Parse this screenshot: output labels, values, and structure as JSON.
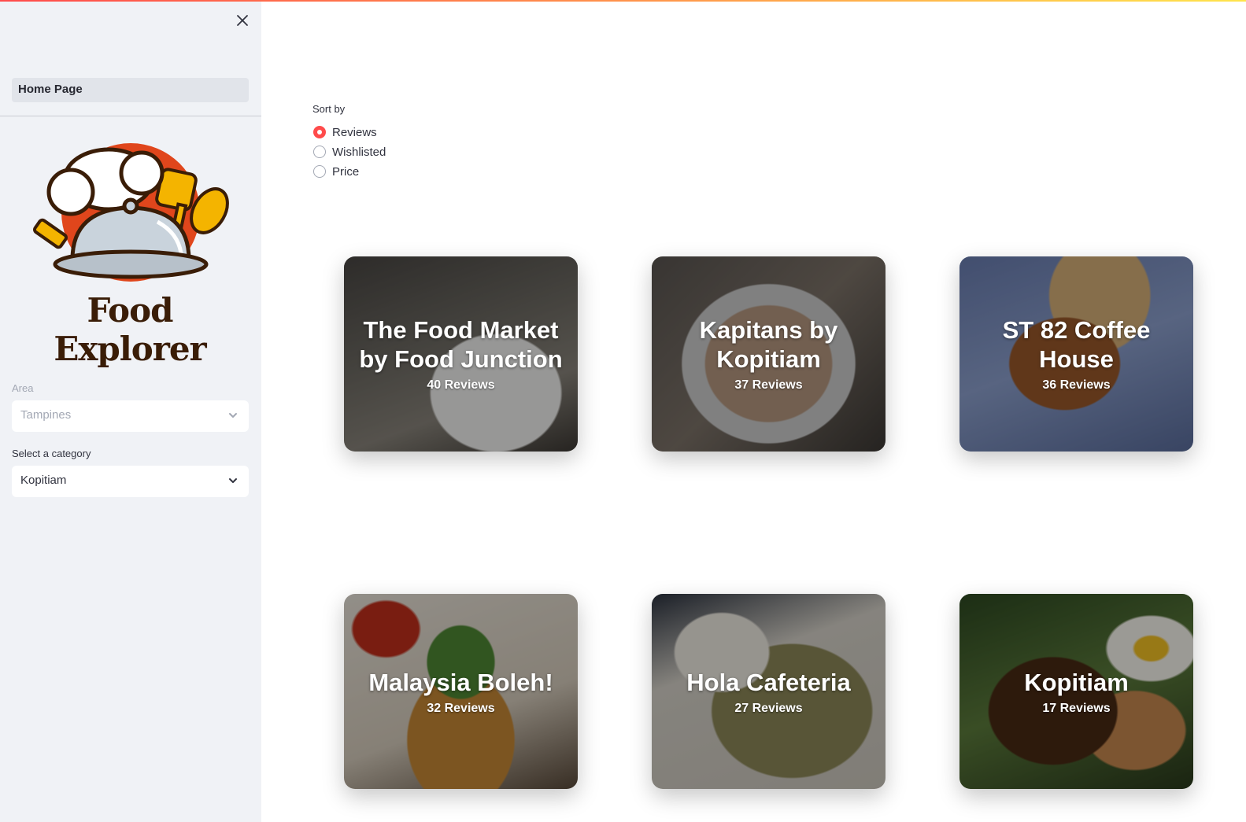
{
  "sidebar": {
    "nav_item": "Home Page",
    "logo_text": "Food Explorer",
    "area": {
      "label": "Area",
      "value": "Tampines"
    },
    "category": {
      "label": "Select a category",
      "value": "Kopitiam"
    }
  },
  "sort": {
    "label": "Sort by",
    "options": [
      "Reviews",
      "Wishlisted",
      "Price"
    ],
    "selected": "Reviews"
  },
  "restaurants": [
    {
      "name": "The Food Market by Food Junction",
      "reviews": "40 Reviews"
    },
    {
      "name": "Kapitans by Kopitiam",
      "reviews": "37 Reviews"
    },
    {
      "name": "ST 82 Coffee House",
      "reviews": "36 Reviews"
    },
    {
      "name": "Malaysia Boleh!",
      "reviews": "32 Reviews"
    },
    {
      "name": "Hola Cafeteria",
      "reviews": "27 Reviews"
    },
    {
      "name": "Kopitiam",
      "reviews": "17 Reviews"
    }
  ],
  "colors": {
    "accent": "#ff4b4b",
    "sidebar_bg": "#f0f2f6",
    "logo_brown": "#3a1d07",
    "logo_orange": "#e0461c"
  }
}
